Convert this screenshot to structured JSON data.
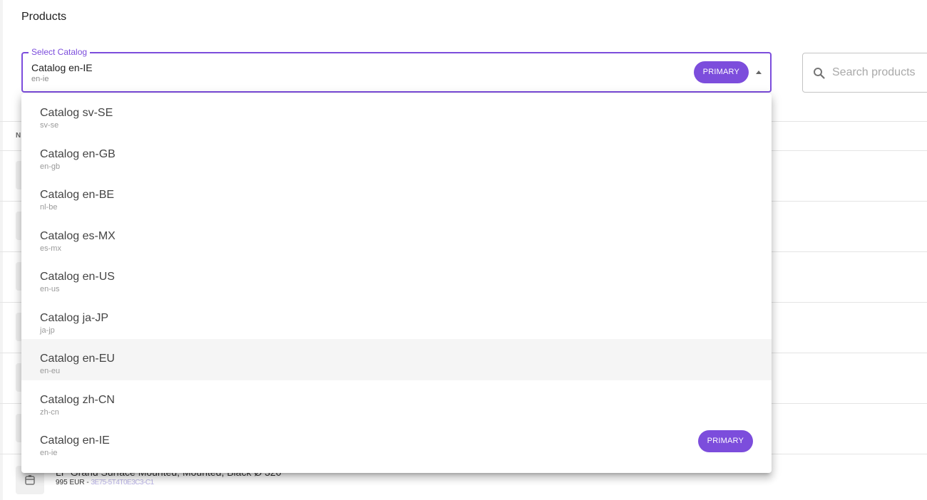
{
  "page": {
    "title": "Products"
  },
  "select": {
    "label": "Select Catalog",
    "value": "Catalog en-IE",
    "sub": "en-ie",
    "badge": "PRIMARY"
  },
  "search": {
    "placeholder": "Search products"
  },
  "table": {
    "header_first_letter": "N",
    "last_row": {
      "name": "LP Grand Surface Mounted, Mounted, Black Ø 320",
      "price": "995 EUR - ",
      "sku": "3E75-5T4T0E3C3-C1"
    }
  },
  "dropdown": {
    "options": [
      {
        "label": "Catalog sv-SE",
        "sub": "sv-se"
      },
      {
        "label": "Catalog en-GB",
        "sub": "en-gb"
      },
      {
        "label": "Catalog en-BE",
        "sub": "nl-be"
      },
      {
        "label": "Catalog es-MX",
        "sub": "es-mx"
      },
      {
        "label": "Catalog en-US",
        "sub": "en-us"
      },
      {
        "label": "Catalog ja-JP",
        "sub": "ja-jp"
      },
      {
        "label": "Catalog en-EU",
        "sub": "en-eu",
        "hovered": true
      },
      {
        "label": "Catalog zh-CN",
        "sub": "zh-cn"
      },
      {
        "label": "Catalog en-IE",
        "sub": "en-ie",
        "badge": "PRIMARY"
      }
    ]
  },
  "colors": {
    "accent": "#7c4ddc",
    "hover": "#f5f5f5",
    "divider": "#e4e4e4"
  },
  "icons": {
    "search": "search-icon",
    "dropdown_caret": "arrow-up-icon",
    "thumbnail": "box-icon"
  }
}
